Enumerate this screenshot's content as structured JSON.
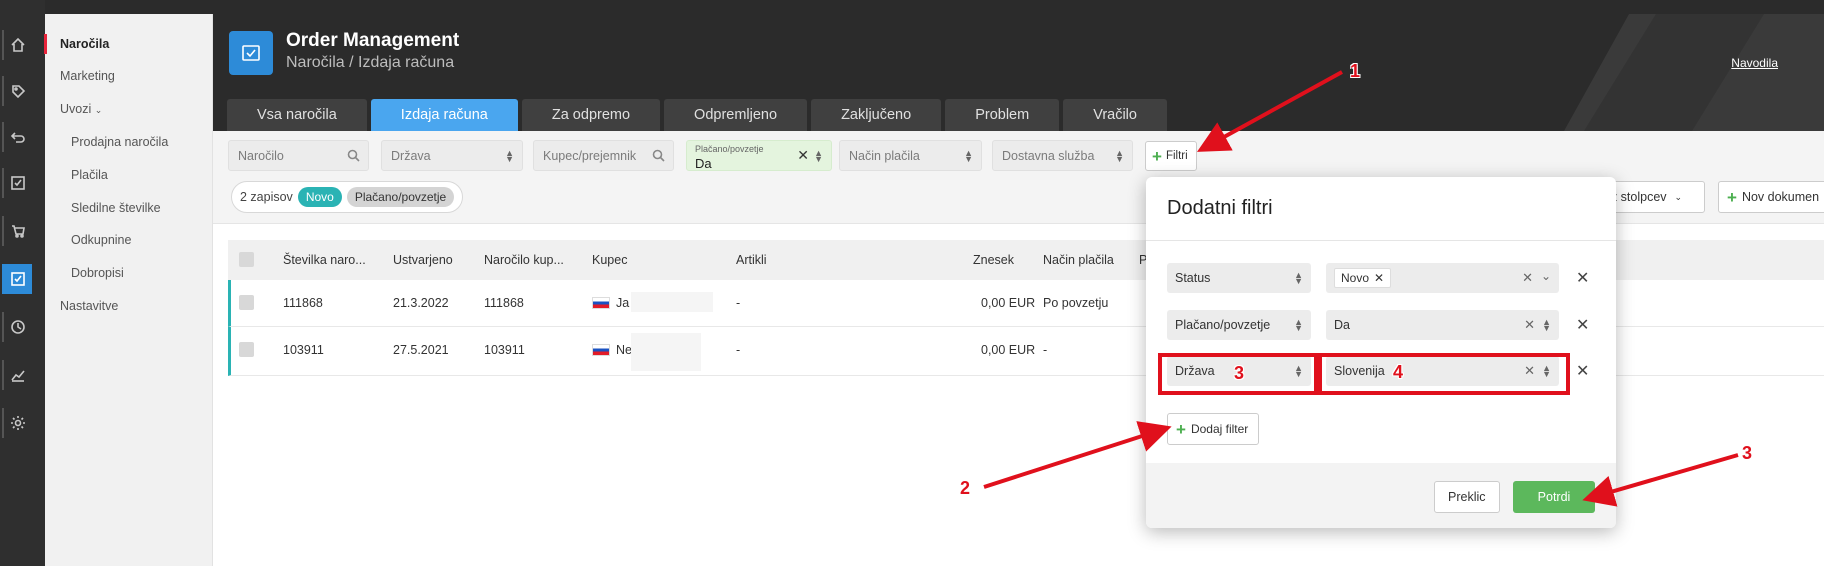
{
  "colors": {
    "accent": "#2d8bd8",
    "tab_active": "#4aa6ef",
    "teal": "#2ab3b4",
    "confirm": "#5cb85c",
    "annotation": "#e0101c"
  },
  "rail": [
    "home-icon",
    "tag-icon",
    "return-icon",
    "checklist-icon",
    "cart-icon",
    "order-icon",
    "clock-icon",
    "chart-icon",
    "gear-icon"
  ],
  "sidebar": {
    "items": [
      {
        "label": "Naročila"
      },
      {
        "label": "Marketing"
      },
      {
        "label": "Uvozi"
      },
      {
        "label": "Prodajna naročila"
      },
      {
        "label": "Plačila"
      },
      {
        "label": "Sledilne številke"
      },
      {
        "label": "Odkupnine"
      },
      {
        "label": "Dobropisi"
      },
      {
        "label": "Nastavitve"
      }
    ]
  },
  "header": {
    "title": "Order Management",
    "breadcrumb": "Naročila / Izdaja računa",
    "help": "Navodila"
  },
  "tabs": [
    "Vsa naročila",
    "Izdaja računa",
    "Za odpremo",
    "Odpremljeno",
    "Zaključeno",
    "Problem",
    "Vračilo"
  ],
  "filters": {
    "order_placeholder": "Naročilo",
    "country_placeholder": "Država",
    "customer_placeholder": "Kupec/prejemnik",
    "paid_label": "Plačano/povzetje",
    "paid_value": "Da",
    "payment_placeholder": "Način plačila",
    "delivery_placeholder": "Dostavna služba",
    "more_button": "Filtri"
  },
  "summary": {
    "count": "2 zapisov",
    "chip_novo": "Novo",
    "chip_paid": "Plačano/povzetje"
  },
  "toolbar": {
    "columns": "az stolpcev",
    "new_doc": "Nov dokumen"
  },
  "table": {
    "headers": [
      "Številka naro...",
      "Ustvarjeno",
      "Naročilo kup...",
      "Kupec",
      "Artikli",
      "Znesek",
      "Način plačila",
      "P"
    ],
    "rows": [
      {
        "number": "111868",
        "created": "21.3.2022",
        "customer_order": "111868",
        "customer": "Ja",
        "items": "-",
        "amount": "0,00 EUR",
        "payment": "Po povzetju"
      },
      {
        "number": "103911",
        "created": "27.5.2021",
        "customer_order": "103911",
        "customer": "Ne",
        "items": "-",
        "amount": "0,00 EUR",
        "payment": "-"
      }
    ]
  },
  "modal": {
    "title": "Dodatni filtri",
    "rows": [
      {
        "field": "Status",
        "value_tag": "Novo"
      },
      {
        "field": "Plačano/povzetje",
        "value": "Da"
      },
      {
        "field": "Država",
        "value": "Slovenija"
      }
    ],
    "add_filter": "Dodaj filter",
    "cancel": "Preklic",
    "confirm": "Potrdi"
  },
  "annotations": [
    "1",
    "2",
    "3",
    "3",
    "4"
  ]
}
